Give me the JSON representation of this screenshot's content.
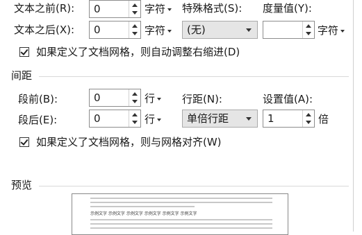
{
  "indent": {
    "before_label": "文本之前(R):",
    "before_value": "0",
    "before_unit": "字符",
    "after_label": "文本之后(X):",
    "after_value": "0",
    "after_unit": "字符",
    "special_label": "特殊格式(S):",
    "special_value": "(无)",
    "measure_label": "度量值(Y):",
    "measure_value": "",
    "measure_unit": "字符",
    "grid_checkbox_label": "如果定义了文档网格，则自动调整右缩进(D)",
    "grid_checkbox_checked": true
  },
  "spacing": {
    "section_title": "间距",
    "before_label": "段前(B):",
    "before_value": "0",
    "before_unit": "行",
    "after_label": "段后(E):",
    "after_value": "0",
    "after_unit": "行",
    "line_spacing_label": "行距(N):",
    "line_spacing_value": "单倍行距",
    "setting_label": "设置值(A):",
    "setting_value": "1",
    "setting_unit": "倍",
    "grid_checkbox_label": "如果定义了文档网格，则与网格对齐(W)",
    "grid_checkbox_checked": true
  },
  "preview": {
    "section_title": "预览",
    "sample_text": "示例文字 示例文字 示例文字 示例文字 示例文字 示例文字"
  },
  "icons": {
    "check": "checkmark-icon",
    "spin": "spin-arrows-icon",
    "dropdown": "chevron-down-icon"
  }
}
